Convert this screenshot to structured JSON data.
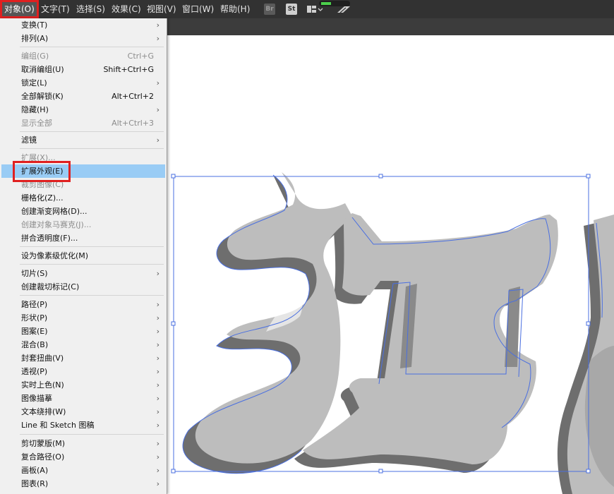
{
  "menubar": {
    "items": [
      {
        "label": "对象(O)"
      },
      {
        "label": "文字(T)"
      },
      {
        "label": "选择(S)"
      },
      {
        "label": "效果(C)"
      },
      {
        "label": "视图(V)"
      },
      {
        "label": "窗口(W)"
      },
      {
        "label": "帮助(H)"
      }
    ],
    "toolbar_icons": [
      {
        "icon": "bridge-icon",
        "label": "Br"
      },
      {
        "icon": "stock-icon",
        "label": "St"
      },
      {
        "icon": "arrange-documents-icon"
      },
      {
        "icon": "gpu-performance-icon"
      }
    ]
  },
  "menu": {
    "items": [
      {
        "label": "变换(T)",
        "shortcut": "",
        "submenu": true,
        "disabled": false
      },
      {
        "label": "排列(A)",
        "shortcut": "",
        "submenu": true,
        "disabled": false
      },
      {
        "label": "编组(G)",
        "shortcut": "Ctrl+G",
        "submenu": false,
        "disabled": true
      },
      {
        "label": "取消编组(U)",
        "shortcut": "Shift+Ctrl+G",
        "submenu": false,
        "disabled": false
      },
      {
        "label": "锁定(L)",
        "shortcut": "",
        "submenu": true,
        "disabled": false
      },
      {
        "label": "全部解锁(K)",
        "shortcut": "Alt+Ctrl+2",
        "submenu": false,
        "disabled": false
      },
      {
        "label": "隐藏(H)",
        "shortcut": "",
        "submenu": true,
        "disabled": false
      },
      {
        "label": "显示全部",
        "shortcut": "Alt+Ctrl+3",
        "submenu": false,
        "disabled": true
      },
      {
        "label": "滤镜",
        "shortcut": "",
        "submenu": true,
        "disabled": false
      },
      {
        "label": "扩展(X)...",
        "shortcut": "",
        "submenu": false,
        "disabled": true
      },
      {
        "label": "扩展外观(E)",
        "shortcut": "",
        "submenu": false,
        "disabled": false,
        "highlighted": true
      },
      {
        "label": "裁剪图像(C)",
        "shortcut": "",
        "submenu": false,
        "disabled": true
      },
      {
        "label": "栅格化(Z)...",
        "shortcut": "",
        "submenu": false,
        "disabled": false
      },
      {
        "label": "创建渐变网格(D)...",
        "shortcut": "",
        "submenu": false,
        "disabled": false
      },
      {
        "label": "创建对象马赛克(J)...",
        "shortcut": "",
        "submenu": false,
        "disabled": true
      },
      {
        "label": "拼合透明度(F)...",
        "shortcut": "",
        "submenu": false,
        "disabled": false
      },
      {
        "label": "设为像素级优化(M)",
        "shortcut": "",
        "submenu": false,
        "disabled": false
      },
      {
        "label": "切片(S)",
        "shortcut": "",
        "submenu": true,
        "disabled": false
      },
      {
        "label": "创建裁切标记(C)",
        "shortcut": "",
        "submenu": false,
        "disabled": false
      },
      {
        "label": "路径(P)",
        "shortcut": "",
        "submenu": true,
        "disabled": false
      },
      {
        "label": "形状(P)",
        "shortcut": "",
        "submenu": true,
        "disabled": false
      },
      {
        "label": "图案(E)",
        "shortcut": "",
        "submenu": true,
        "disabled": false
      },
      {
        "label": "混合(B)",
        "shortcut": "",
        "submenu": true,
        "disabled": false
      },
      {
        "label": "封套扭曲(V)",
        "shortcut": "",
        "submenu": true,
        "disabled": false
      },
      {
        "label": "透视(P)",
        "shortcut": "",
        "submenu": true,
        "disabled": false
      },
      {
        "label": "实时上色(N)",
        "shortcut": "",
        "submenu": true,
        "disabled": false
      },
      {
        "label": "图像描摹",
        "shortcut": "",
        "submenu": true,
        "disabled": false
      },
      {
        "label": "文本绕排(W)",
        "shortcut": "",
        "submenu": true,
        "disabled": false
      },
      {
        "label": "Line 和 Sketch 图稿",
        "shortcut": "",
        "submenu": true,
        "disabled": false
      },
      {
        "label": "剪切蒙版(M)",
        "shortcut": "",
        "submenu": true,
        "disabled": false
      },
      {
        "label": "复合路径(O)",
        "shortcut": "",
        "submenu": true,
        "disabled": false
      },
      {
        "label": "画板(A)",
        "shortcut": "",
        "submenu": true,
        "disabled": false
      },
      {
        "label": "图表(R)",
        "shortcut": "",
        "submenu": true,
        "disabled": false
      }
    ]
  },
  "colors": {
    "menubar_bg": "#323232",
    "menu_bg": "#f0f0f0",
    "highlight": "#99ccf5",
    "annotation_red": "#e02020",
    "selection_blue": "#4a6fe0",
    "text_front": "#bdbdbd",
    "text_shadow": "#6e6e6e"
  }
}
